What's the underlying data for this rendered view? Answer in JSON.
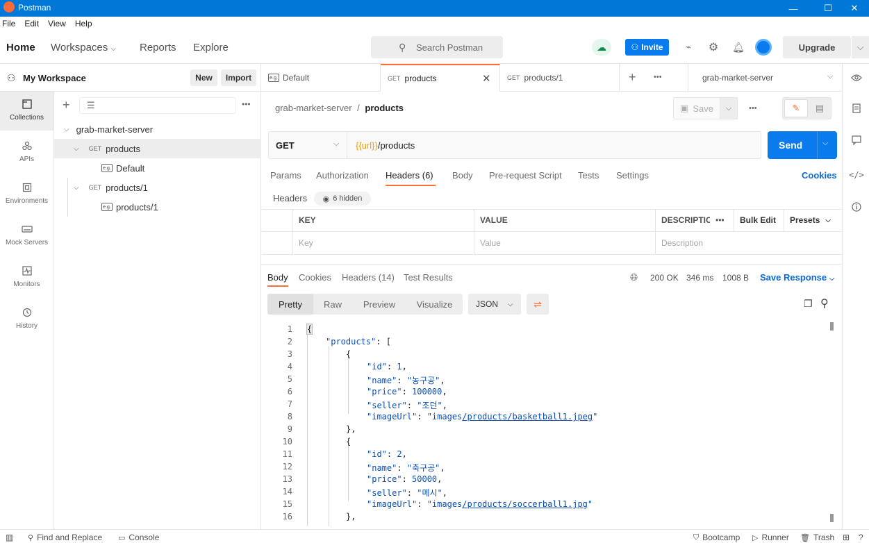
{
  "app_title": "Postman",
  "menu": [
    "File",
    "Edit",
    "View",
    "Help"
  ],
  "header": {
    "home": "Home",
    "workspaces": "Workspaces",
    "reports": "Reports",
    "explore": "Explore",
    "search_placeholder": "Search Postman",
    "invite": "Invite",
    "upgrade": "Upgrade"
  },
  "workspace": {
    "title": "My Workspace",
    "new": "New",
    "import": "Import"
  },
  "sidenav": [
    {
      "label": "Collections",
      "icon": "collections-icon"
    },
    {
      "label": "APIs",
      "icon": "apis-icon"
    },
    {
      "label": "Environments",
      "icon": "environments-icon"
    },
    {
      "label": "Mock Servers",
      "icon": "mock-servers-icon"
    },
    {
      "label": "Monitors",
      "icon": "monitors-icon"
    },
    {
      "label": "History",
      "icon": "history-icon"
    }
  ],
  "tree": {
    "collection": "grab-market-server",
    "items": [
      {
        "method": "GET",
        "name": "products",
        "example": "Default"
      },
      {
        "method": "GET",
        "name": "products/1",
        "example": "products/1"
      }
    ]
  },
  "tabs": [
    {
      "label": "Default",
      "method": ""
    },
    {
      "label": "products",
      "method": "GET"
    },
    {
      "label": "products/1",
      "method": "GET"
    }
  ],
  "environment": "grab-market-server",
  "breadcrumb": {
    "parent": "grab-market-server",
    "sep": "/",
    "current": "products"
  },
  "save_label": "Save",
  "request": {
    "method": "GET",
    "url_var": "{{url}}",
    "url_path": "/products",
    "send": "Send"
  },
  "req_tabs": [
    "Params",
    "Authorization",
    "Headers (6)",
    "Body",
    "Pre-request Script",
    "Tests",
    "Settings"
  ],
  "cookies_link": "Cookies",
  "headers_section": {
    "label": "Headers",
    "hidden": "6 hidden"
  },
  "header_table": {
    "columns": [
      "KEY",
      "VALUE",
      "DESCRIPTIO"
    ],
    "placeholders": [
      "Key",
      "Value",
      "Description"
    ],
    "bulk_edit": "Bulk Edit",
    "presets": "Presets"
  },
  "response": {
    "tabs": [
      "Body",
      "Cookies",
      "Headers (14)",
      "Test Results"
    ],
    "status": "200 OK",
    "time": "346 ms",
    "size": "1008 B",
    "save_response": "Save Response"
  },
  "view_tabs": [
    "Pretty",
    "Raw",
    "Preview",
    "Visualize"
  ],
  "format": "JSON",
  "code_lines": [
    "1",
    "2",
    "3",
    "4",
    "5",
    "6",
    "7",
    "8",
    "9",
    "10",
    "11",
    "12",
    "13",
    "14",
    "15",
    "16"
  ],
  "code": {
    "l1": "{",
    "l2k": "\"products\"",
    "l2r": ": [",
    "l3": "{",
    "l4k": "\"id\"",
    "l4v": "1",
    "l5k": "\"name\"",
    "l5v": "\"농구공\"",
    "l6k": "\"price\"",
    "l6v": "100000",
    "l7k": "\"seller\"",
    "l7v": "\"조던\"",
    "l8k": "\"imageUrl\"",
    "l8v1": "\"images",
    "l8v2": "/products/basketball1.jpeg",
    "l8v3": "\"",
    "l9": "},",
    "l10": "{",
    "l11k": "\"id\"",
    "l11v": "2",
    "l12k": "\"name\"",
    "l12v": "\"축구공\"",
    "l13k": "\"price\"",
    "l13v": "50000",
    "l14k": "\"seller\"",
    "l14v": "\"메시\"",
    "l15k": "\"imageUrl\"",
    "l15v1": "\"images",
    "l15v2": "/products/soccerball1.jpg",
    "l15v3": "\"",
    "l16": "},"
  },
  "statusbar": {
    "find": "Find and Replace",
    "console": "Console",
    "bootcamp": "Bootcamp",
    "runner": "Runner",
    "trash": "Trash"
  },
  "colors": {
    "accent": "#097bed",
    "brand": "#ff6c37",
    "titlebar": "#0078d7"
  }
}
